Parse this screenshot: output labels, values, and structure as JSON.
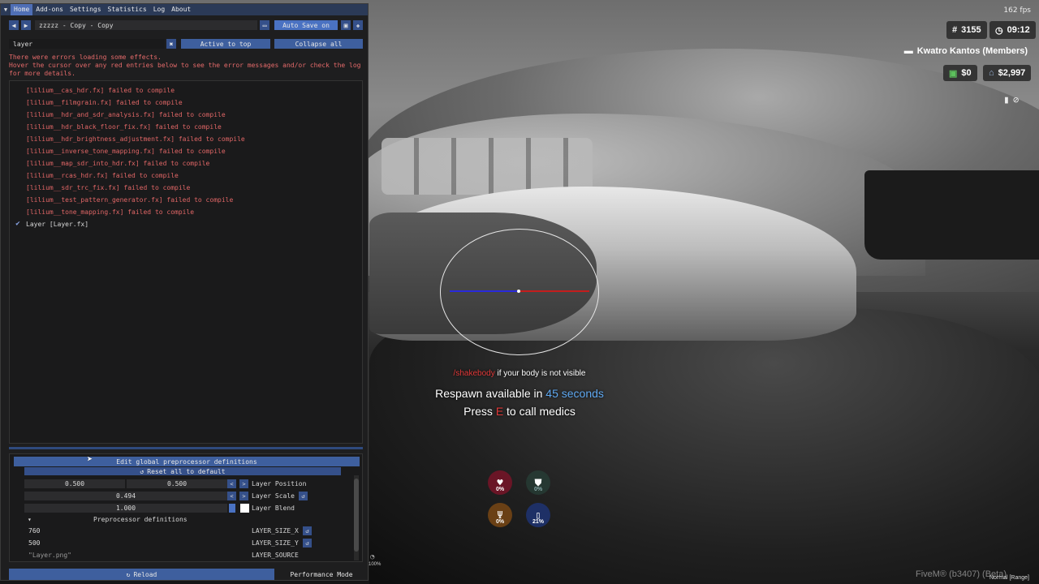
{
  "reshade": {
    "menu": [
      "Home",
      "Add-ons",
      "Settings",
      "Statistics",
      "Log",
      "About"
    ],
    "preset_name": "zzzzz - Copy - Copy",
    "auto_save": "Auto Save on",
    "search_value": "layer",
    "active_to_top": "Active to top",
    "collapse_all": "Collapse all",
    "error_lines": [
      "There were errors loading some effects.",
      "Hover the cursor over any red entries below to see the error messages and/or check the log",
      "for more details."
    ],
    "effects": [
      {
        "label": "[lilium__cas_hdr.fx] failed to compile",
        "status": "fail"
      },
      {
        "label": "[lilium__filmgrain.fx] failed to compile",
        "status": "fail"
      },
      {
        "label": "[lilium__hdr_and_sdr_analysis.fx] failed to compile",
        "status": "fail"
      },
      {
        "label": "[lilium__hdr_black_floor_fix.fx] failed to compile",
        "status": "fail"
      },
      {
        "label": "[lilium__hdr_brightness_adjustment.fx] failed to compile",
        "status": "fail"
      },
      {
        "label": "[lilium__inverse_tone_mapping.fx] failed to compile",
        "status": "fail"
      },
      {
        "label": "[lilium__map_sdr_into_hdr.fx] failed to compile",
        "status": "fail"
      },
      {
        "label": "[lilium__rcas_hdr.fx] failed to compile",
        "status": "fail"
      },
      {
        "label": "[lilium__sdr_trc_fix.fx] failed to compile",
        "status": "fail"
      },
      {
        "label": "[lilium__test_pattern_generator.fx] failed to compile",
        "status": "fail"
      },
      {
        "label": "[lilium__tone_mapping.fx] failed to compile",
        "status": "fail"
      },
      {
        "label": "Layer [Layer.fx]",
        "status": "ok"
      }
    ],
    "edit_global": "Edit global preprocessor definitions",
    "reset_all": "Reset all to default",
    "layer_position": {
      "label": "Layer Position",
      "x": "0.500",
      "y": "0.500"
    },
    "layer_scale": {
      "label": "Layer Scale",
      "value": "0.494"
    },
    "layer_blend": {
      "label": "Layer Blend",
      "value": "1.000"
    },
    "preproc_header": "Preprocessor definitions",
    "preproc": [
      {
        "value": "760",
        "name": "LAYER_SIZE_X"
      },
      {
        "value": "500",
        "name": "LAYER_SIZE_Y"
      },
      {
        "value": "\"Layer.png\"",
        "name": "LAYER_SOURCE"
      }
    ],
    "reload": "Reload",
    "performance_mode": "Performance Mode"
  },
  "hud": {
    "fps": "162 fps",
    "player_id": "3155",
    "time": "09:12",
    "player_name": "Kwatro Kantos (Members)",
    "cash": "$0",
    "bank": "$2,997",
    "shakebody_cmd": "/shakebody",
    "shakebody_rest": "if your body is not visible",
    "respawn_prefix": "Respawn available in",
    "respawn_time": "45 seconds",
    "medics_press": "Press",
    "medics_key": "E",
    "medics_rest": "to call medics",
    "health": "0%",
    "armor": "0%",
    "hunger": "0%",
    "thirst": "21%",
    "zoom": "100%",
    "watermark": "FiveM® (b3407) (Beta)",
    "mode": "Normal [Range]"
  },
  "colors": {
    "accent": "#4a72c2",
    "error": "#e06666",
    "respawn_blue": "#5fa8f0",
    "key_red": "#e03838"
  }
}
